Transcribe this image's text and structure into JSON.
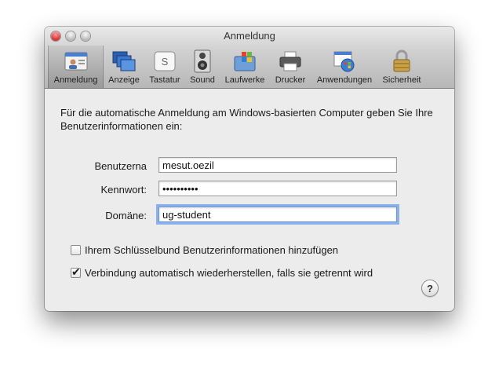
{
  "window": {
    "title": "Anmeldung"
  },
  "toolbar": {
    "items": [
      {
        "label": "Anmeldung",
        "icon": "id-card-icon",
        "selected": true
      },
      {
        "label": "Anzeige",
        "icon": "display-icon",
        "selected": false
      },
      {
        "label": "Tastatur",
        "icon": "keyboard-key-icon",
        "selected": false
      },
      {
        "label": "Sound",
        "icon": "speaker-icon",
        "selected": false
      },
      {
        "label": "Laufwerke",
        "icon": "drive-folder-icon",
        "selected": false
      },
      {
        "label": "Drucker",
        "icon": "printer-icon",
        "selected": false
      },
      {
        "label": "Anwendungen",
        "icon": "applications-icon",
        "selected": false
      },
      {
        "label": "Sicherheit",
        "icon": "lock-icon",
        "selected": false
      }
    ]
  },
  "form": {
    "intro": "Für die automatische Anmeldung am Windows-basierten Computer geben Sie Ihre Benutzerinformationen ein:",
    "username_label": "Benutzerna",
    "username_value": "mesut.oezil",
    "password_label": "Kennwort:",
    "password_value": "••••••••••",
    "domain_label": "Domäne:",
    "domain_value": "ug-student",
    "keychain_label": "Ihrem Schlüsselbund Benutzerinformationen hinzufügen",
    "keychain_checked": false,
    "reconnect_label": "Verbindung automatisch wiederherstellen, falls sie getrennt wird",
    "reconnect_checked": true,
    "help_label": "?"
  }
}
